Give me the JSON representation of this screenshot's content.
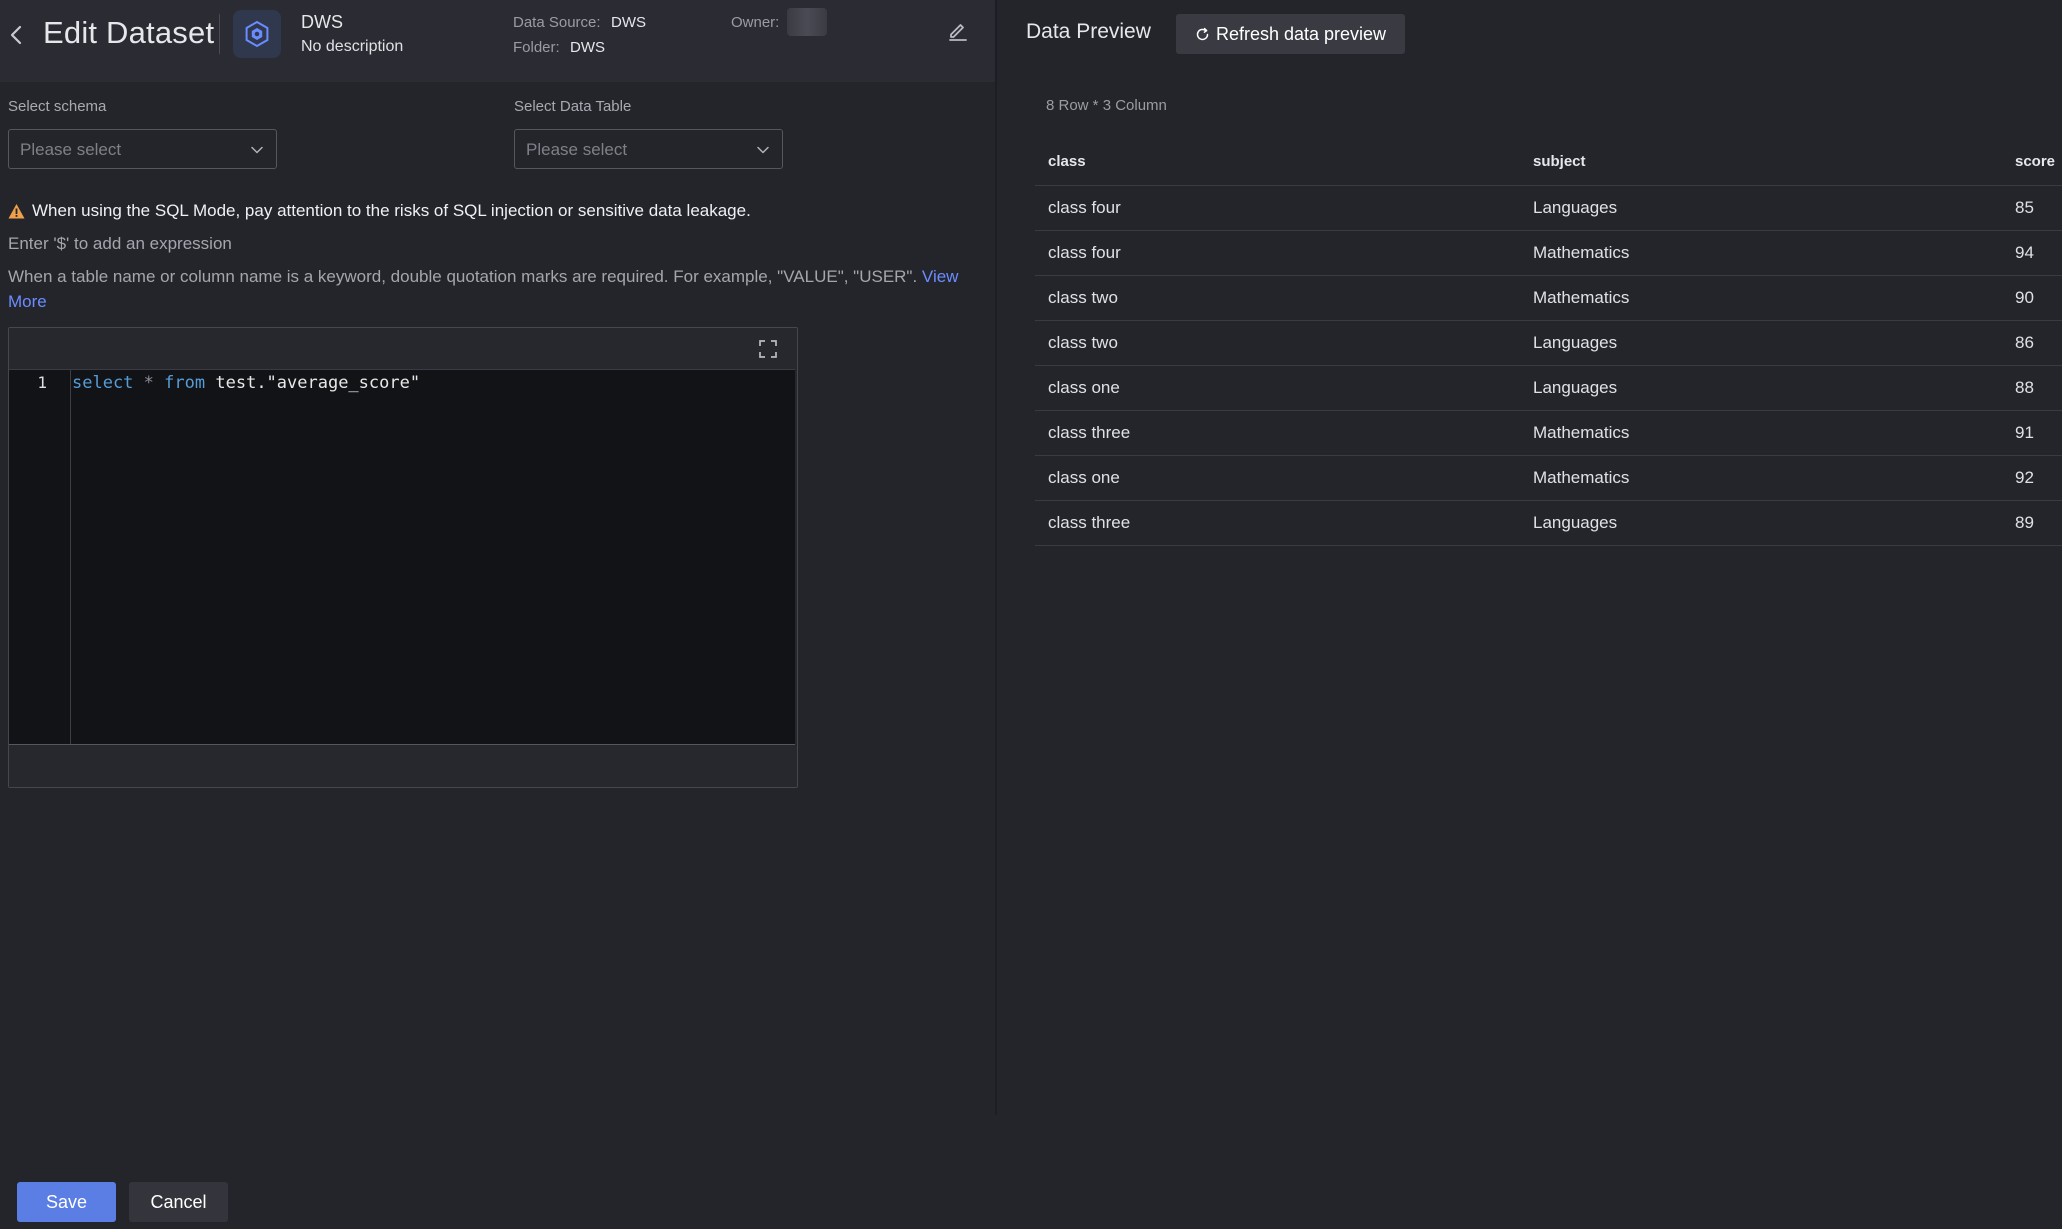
{
  "header": {
    "title": "Edit Dataset",
    "dataset_name": "DWS",
    "description": "No description",
    "data_source_label": "Data Source:",
    "data_source_value": "DWS",
    "folder_label": "Folder:",
    "folder_value": "DWS",
    "owner_label": "Owner:"
  },
  "form": {
    "schema_label": "Select schema",
    "schema_placeholder": "Please select",
    "table_label": "Select Data Table",
    "table_placeholder": "Please select",
    "warning": "When using the SQL Mode, pay attention to the risks of SQL injection or sensitive data leakage.",
    "hint_expression": "Enter '$' to add an expression",
    "hint_keyword": "When a table name or column name is a keyword, double quotation marks are required. For example, \"VALUE\", \"USER\". ",
    "view_more": "View More"
  },
  "editor": {
    "line_number": "1",
    "tokens": {
      "kw1": "select",
      "op": "*",
      "kw2": "from",
      "rest": "test.\"average_score\""
    }
  },
  "footer": {
    "save_label": "Save",
    "cancel_label": "Cancel"
  },
  "preview": {
    "title": "Data Preview",
    "refresh_label": "Refresh data preview",
    "row_count": "8 Row * 3 Column",
    "columns": [
      "class",
      "subject",
      "score"
    ],
    "rows": [
      [
        "class four",
        "Languages",
        "85"
      ],
      [
        "class four",
        "Mathematics",
        "94"
      ],
      [
        "class two",
        "Mathematics",
        "90"
      ],
      [
        "class two",
        "Languages",
        "86"
      ],
      [
        "class one",
        "Languages",
        "88"
      ],
      [
        "class three",
        "Mathematics",
        "91"
      ],
      [
        "class one",
        "Mathematics",
        "92"
      ],
      [
        "class three",
        "Languages",
        "89"
      ]
    ]
  },
  "colors": {
    "accent": "#5b7ee5",
    "link": "#6b8cff",
    "warning": "#f0a04b",
    "background": "#24252b"
  },
  "icons": {
    "back": "chevron-left-icon",
    "dataset": "hexagon-dataset-icon",
    "edit": "pencil-icon",
    "dropdown": "chevron-down-icon",
    "warning": "warning-triangle-icon",
    "fullscreen": "expand-icon",
    "refresh": "refresh-icon"
  }
}
